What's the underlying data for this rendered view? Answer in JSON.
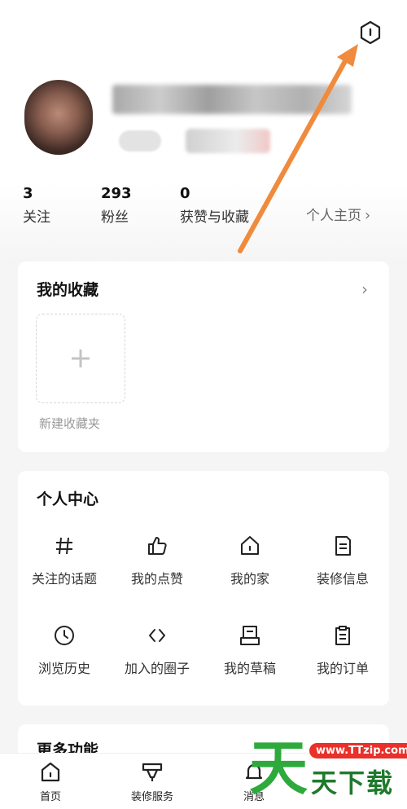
{
  "profile": {
    "stats": [
      {
        "value": "3",
        "label": "关注"
      },
      {
        "value": "293",
        "label": "粉丝"
      },
      {
        "value": "0",
        "label": "获赞与收藏"
      }
    ],
    "homepage_link": "个人主页",
    "chevron": "›"
  },
  "favorites": {
    "title": "我的收藏",
    "new_folder_label": "新建收藏夹",
    "plus": "+"
  },
  "personal_center": {
    "title": "个人中心",
    "items": [
      {
        "label": "关注的话题",
        "icon": "hashtag-icon"
      },
      {
        "label": "我的点赞",
        "icon": "thumbs-up-icon"
      },
      {
        "label": "我的家",
        "icon": "home-icon"
      },
      {
        "label": "装修信息",
        "icon": "document-icon"
      },
      {
        "label": "浏览历史",
        "icon": "clock-icon"
      },
      {
        "label": "加入的圈子",
        "icon": "code-brackets-icon"
      },
      {
        "label": "我的草稿",
        "icon": "draft-icon"
      },
      {
        "label": "我的订单",
        "icon": "clipboard-icon"
      }
    ]
  },
  "more_features": {
    "title": "更多功能"
  },
  "bottom_nav": [
    {
      "label": "首页",
      "icon": "home-icon"
    },
    {
      "label": "装修服务",
      "icon": "service-icon"
    },
    {
      "label": "消息",
      "icon": "bell-icon"
    }
  ],
  "watermark": {
    "big": "天",
    "text": "天下载",
    "site": "www.TTzip.com"
  },
  "colors": {
    "accent_orange": "#f08a3c",
    "watermark_green": "#2eaa3c",
    "watermark_red": "#e9302a"
  }
}
